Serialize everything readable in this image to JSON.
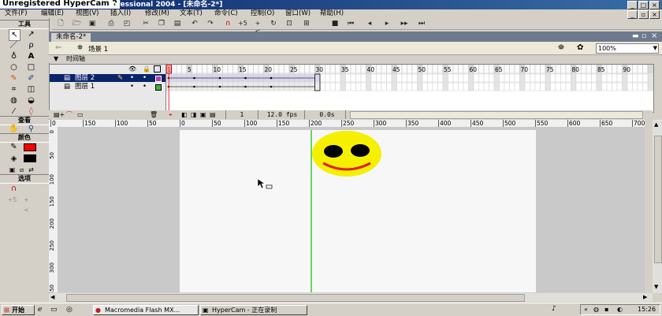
{
  "window": {
    "hypercam_label": "Unregistered HyperCam 2",
    "title": "rofessional 2004 - [未命名-2*]"
  },
  "menu": [
    "文件(F)",
    "编辑(E)",
    "视图(V)",
    "插入(I)",
    "修改(M)",
    "文本(T)",
    "命令(C)",
    "控制(O)",
    "窗口(W)",
    "帮助(H)"
  ],
  "tools_panel": {
    "title": "工具",
    "view_title": "查看",
    "colors_title": "颜色",
    "options_title": "选项"
  },
  "document": {
    "tab": "未命名-2*",
    "scene": "场景 1",
    "zoom": "100%"
  },
  "timeline": {
    "label": "时间轴",
    "ruler": [
      "1",
      "5",
      "10",
      "15",
      "20",
      "25",
      "30",
      "35",
      "40",
      "45",
      "50",
      "55",
      "60",
      "65",
      "70",
      "75",
      "80",
      "85",
      "90"
    ],
    "layers": [
      {
        "name": "图层 2",
        "selected": true
      },
      {
        "name": "图层 1",
        "selected": false
      }
    ],
    "current_frame": "1",
    "fps": "12.0 fps",
    "time": "0.0s"
  },
  "rulers": {
    "top": [
      "0",
      "150",
      "100",
      "50",
      "0",
      "50",
      "100",
      "150",
      "200",
      "250",
      "300",
      "350",
      "400",
      "450",
      "500",
      "550",
      "600",
      "650",
      "700"
    ],
    "left": [
      "0",
      "50",
      "100",
      "150",
      "200",
      "250",
      "300",
      "350"
    ]
  },
  "stage": {
    "smiley_color": "#f5f000",
    "guide_color": "#33cc33"
  },
  "taskbar": {
    "start": "开始",
    "tasks": [
      "Macromedia Flash MX...",
      "HyperCam - 正在录制"
    ],
    "clock": "15:26"
  }
}
